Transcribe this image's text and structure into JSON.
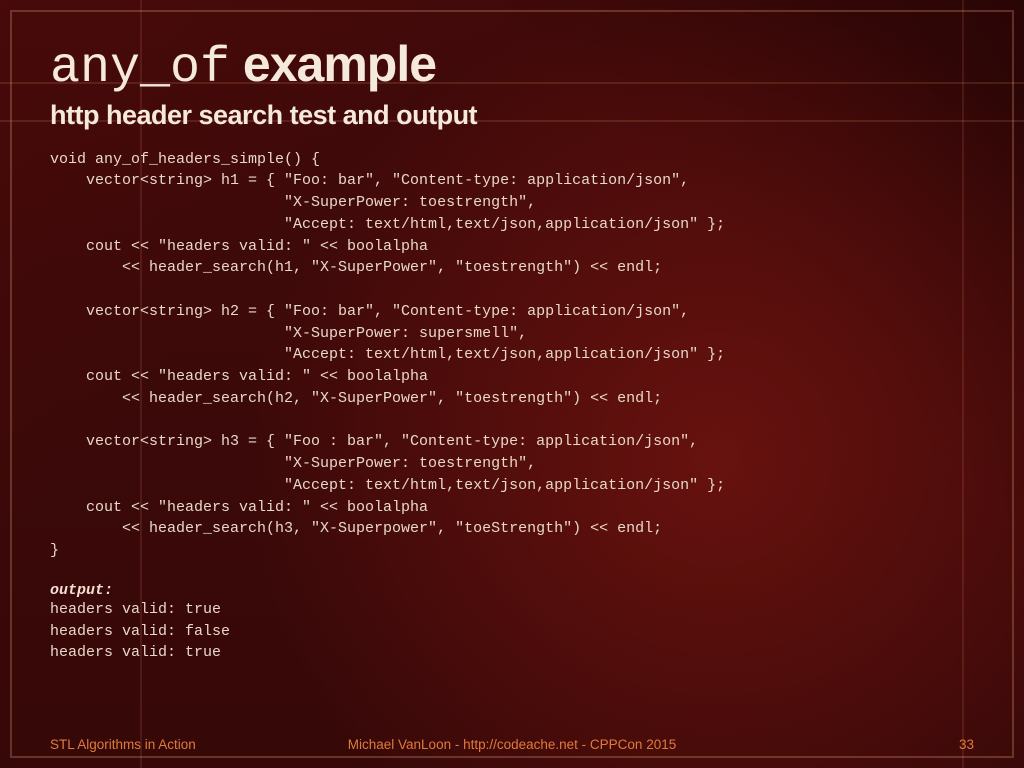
{
  "title_mono": "any_of",
  "title_rest": " example",
  "subtitle": "http header search test and output",
  "code": "void any_of_headers_simple() {\n    vector<string> h1 = { \"Foo: bar\", \"Content-type: application/json\",\n                          \"X-SuperPower: toestrength\",\n                          \"Accept: text/html,text/json,application/json\" };\n    cout << \"headers valid: \" << boolalpha\n        << header_search(h1, \"X-SuperPower\", \"toestrength\") << endl;\n\n    vector<string> h2 = { \"Foo: bar\", \"Content-type: application/json\",\n                          \"X-SuperPower: supersmell\",\n                          \"Accept: text/html,text/json,application/json\" };\n    cout << \"headers valid: \" << boolalpha\n        << header_search(h2, \"X-SuperPower\", \"toestrength\") << endl;\n\n    vector<string> h3 = { \"Foo : bar\", \"Content-type: application/json\",\n                          \"X-SuperPower: toestrength\",\n                          \"Accept: text/html,text/json,application/json\" };\n    cout << \"headers valid: \" << boolalpha\n        << header_search(h3, \"X-Superpower\", \"toeStrength\") << endl;\n}",
  "output_label": "output:",
  "output": "headers valid: true\nheaders valid: false\nheaders valid: true",
  "footer": {
    "left": "STL Algorithms in Action",
    "center": "Michael VanLoon - http://codeache.net - CPPCon 2015",
    "right": "33"
  }
}
